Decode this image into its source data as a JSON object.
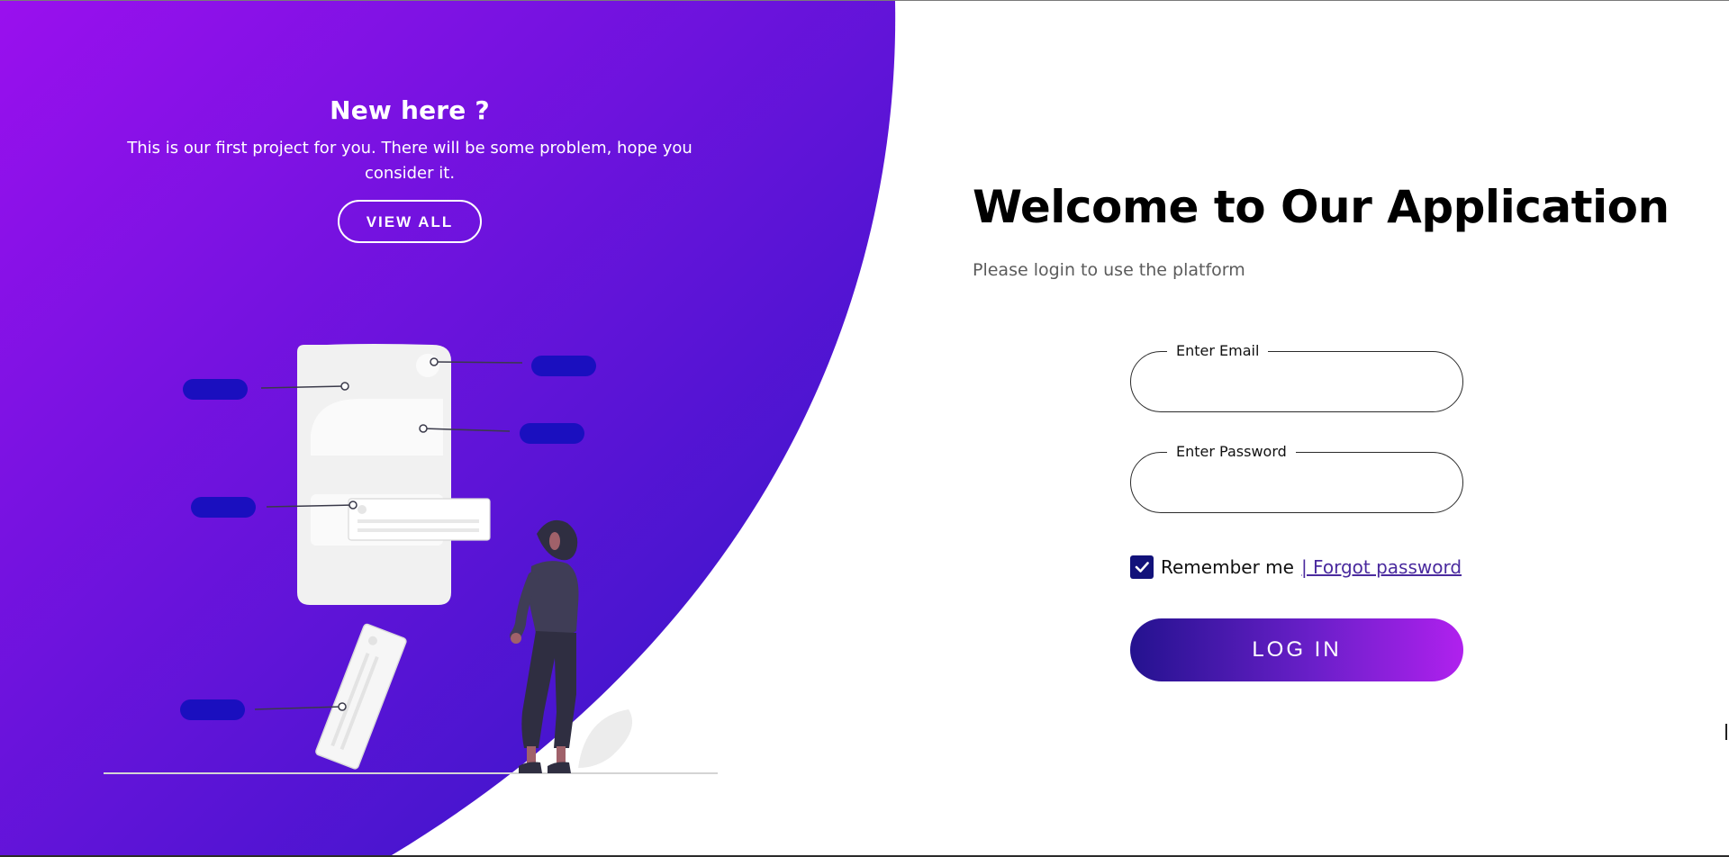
{
  "colors": {
    "gradient_start": "#9a10ee",
    "gradient_end": "#2c17c4",
    "accent_pill": "#1a0fbf",
    "login_gradient_start": "#24128f",
    "login_gradient_end": "#b021ee",
    "link": "#4a2a9e"
  },
  "promo": {
    "title": "New here ?",
    "text": "This is our first project for you. There will be some problem, hope you consider it.",
    "button_label": "VIEW ALL"
  },
  "illustration": {
    "icon": "person-with-phone-illustration"
  },
  "login": {
    "title": "Welcome to Our Application",
    "subtitle": "Please login to use the platform",
    "email_label": "Enter Email",
    "email_value": "",
    "password_label": "Enter Password",
    "password_value": "",
    "remember_label": "Remember me",
    "remember_checked": true,
    "forgot_label": "| Forgot password",
    "login_button": "LOG IN"
  }
}
